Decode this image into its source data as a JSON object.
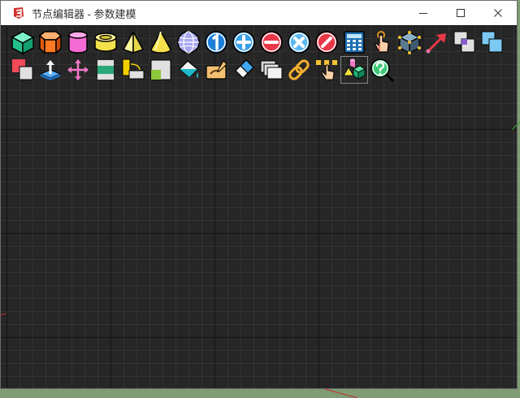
{
  "window": {
    "title": "节点编辑器 - 参数建模",
    "icon": "sketchup-logo-icon",
    "controls": [
      "minimize-icon",
      "maximize-icon",
      "close-icon"
    ]
  },
  "toolbar": {
    "row1": [
      "cube-icon",
      "hexagonal-prism-icon",
      "cylinder-icon",
      "tube-icon",
      "pyramid-icon",
      "cone-icon",
      "sphere-icon",
      "number-one-icon",
      "add-icon",
      "subtract-icon",
      "intersect-icon",
      "slash-icon",
      "calculator-icon",
      "touch-point-icon",
      "box-vertices-icon",
      "arrow-vector-icon",
      "offset-squares-icon",
      "overlap-squares-icon"
    ],
    "row2": [
      "square-difference-icon",
      "push-pull-icon",
      "move-arrows-icon",
      "stack-layers-icon",
      "rotate-rectangle-icon",
      "scale-rectangle-icon",
      "paint-bucket-icon",
      "hand-material-icon",
      "eraser-icon",
      "copy-windows-icon",
      "chain-link-icon",
      "select-vertices-icon",
      "components-icon",
      "help-search-icon"
    ],
    "active": "components-icon"
  },
  "colors": {
    "canvas": "#262626",
    "titlebar": "#ffffff",
    "desktop": "#7f9c73"
  }
}
